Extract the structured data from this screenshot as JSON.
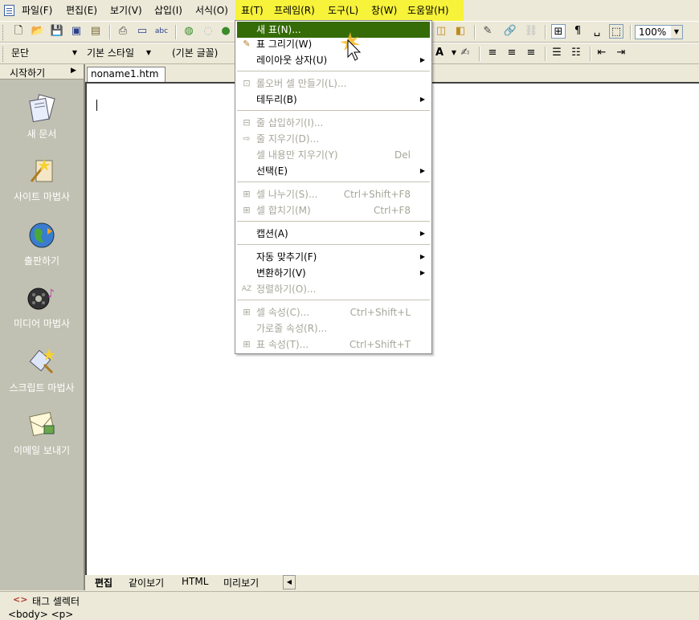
{
  "menubar": {
    "items": [
      "파일(F)",
      "편집(E)",
      "보기(V)",
      "삽입(I)",
      "서식(O)",
      "표(T)",
      "프레임(R)",
      "도구(L)",
      "창(W)",
      "도움말(H)"
    ]
  },
  "toolbar2": {
    "paragraph_combo": "문단",
    "style_combo": "기본 스타일",
    "font_combo": "(기본 글꼴)"
  },
  "toolbar1": {
    "zoom": "100%"
  },
  "sidebar": {
    "header": "시작하기",
    "items": [
      {
        "label": "새 문서",
        "icon": "new-document-icon"
      },
      {
        "label": "사이트 마법사",
        "icon": "site-wizard-icon"
      },
      {
        "label": "출판하기",
        "icon": "publish-icon"
      },
      {
        "label": "미디어 마법사",
        "icon": "media-wizard-icon"
      },
      {
        "label": "스크립트 마법사",
        "icon": "script-wizard-icon"
      },
      {
        "label": "이메일 보내기",
        "icon": "email-icon"
      }
    ]
  },
  "document": {
    "tab_name": "noname1.htm"
  },
  "bottom_tabs": [
    "편집",
    "같이보기",
    "HTML",
    "미리보기"
  ],
  "statusbar": {
    "tag_selector_label": "태그 셀렉터",
    "tag_path": "<body> <p>"
  },
  "table_menu": {
    "items": [
      {
        "label": "새 표(N)...",
        "shortcut": "",
        "highlighted": true,
        "disabled": false
      },
      {
        "label": "표 그리기(W)",
        "shortcut": "",
        "disabled": false
      },
      {
        "label": "레이아웃 상자(U)",
        "shortcut": "",
        "submenu": true,
        "disabled": false
      },
      {
        "label": "롤오버 셀 만들기(L)...",
        "shortcut": "",
        "disabled": true
      },
      {
        "label": "테두리(B)",
        "shortcut": "",
        "submenu": true,
        "disabled": false
      },
      {
        "label": "줄 삽입하기(I)...",
        "shortcut": "",
        "disabled": true
      },
      {
        "label": "줄 지우기(D)...",
        "shortcut": "",
        "disabled": true
      },
      {
        "label": "셀 내용만 지우기(Y)",
        "shortcut": "Del",
        "disabled": true
      },
      {
        "label": "선택(E)",
        "shortcut": "",
        "submenu": true,
        "disabled": false
      },
      {
        "label": "셀 나누기(S)...",
        "shortcut": "Ctrl+Shift+F8",
        "disabled": true
      },
      {
        "label": "셀 합치기(M)",
        "shortcut": "Ctrl+F8",
        "disabled": true
      },
      {
        "label": "캡션(A)",
        "shortcut": "",
        "submenu": true,
        "disabled": false
      },
      {
        "label": "자동 맞추기(F)",
        "shortcut": "",
        "submenu": true,
        "disabled": false
      },
      {
        "label": "변환하기(V)",
        "shortcut": "",
        "submenu": true,
        "disabled": false
      },
      {
        "label": "정렬하기(O)...",
        "shortcut": "",
        "disabled": true
      },
      {
        "label": "셀 속성(C)...",
        "shortcut": "Ctrl+Shift+L",
        "disabled": true
      },
      {
        "label": "가로줄 속성(R)...",
        "shortcut": "",
        "disabled": true
      },
      {
        "label": "표 속성(T)...",
        "shortcut": "Ctrl+Shift+T",
        "disabled": true
      }
    ]
  },
  "colors": {
    "menu_highlight": "#356c07",
    "menubar_highlight": "#f7f23a",
    "sidebar_bg": "#c0c1b2"
  }
}
